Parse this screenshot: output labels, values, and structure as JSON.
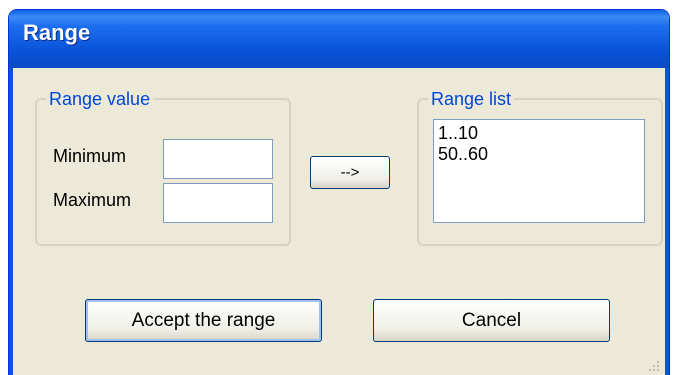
{
  "window": {
    "title": "Range"
  },
  "range_value": {
    "legend": "Range value",
    "minimum_label": "Minimum",
    "maximum_label": "Maximum",
    "minimum_value": "",
    "maximum_value": ""
  },
  "transfer_button": {
    "label": "-->"
  },
  "range_list": {
    "legend": "Range list",
    "items": [
      "1..10",
      "50..60"
    ]
  },
  "buttons": {
    "accept": "Accept the range",
    "cancel": "Cancel"
  }
}
